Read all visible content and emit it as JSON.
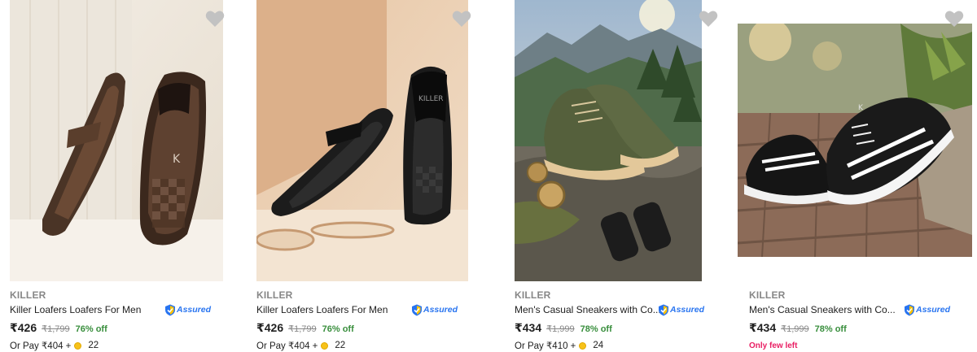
{
  "products": [
    {
      "brand": "KILLER",
      "title": "Killer Loafers Loafers For Men",
      "assured_label": "Assured",
      "price": "₹426",
      "mrp": "₹1,799",
      "discount": "76% off",
      "pay_prefix": "Or Pay ₹404 +",
      "coins": "22",
      "image_icon": "brown-loafers-image"
    },
    {
      "brand": "KILLER",
      "title": "Killer Loafers Loafers For Men",
      "assured_label": "Assured",
      "price": "₹426",
      "mrp": "₹1,799",
      "discount": "76% off",
      "pay_prefix": "Or Pay ₹404 +",
      "coins": "22",
      "image_icon": "black-loafers-image"
    },
    {
      "brand": "KILLER",
      "title": "Men's Casual Sneakers with Co...",
      "assured_label": "Assured",
      "price": "₹434",
      "mrp": "₹1,999",
      "discount": "78% off",
      "pay_prefix": "Or Pay ₹410 +",
      "coins": "24",
      "image_icon": "olive-sneakers-image"
    },
    {
      "brand": "KILLER",
      "title": "Men's Casual Sneakers with Co...",
      "assured_label": "Assured",
      "price": "₹434",
      "mrp": "₹1,999",
      "discount": "78% off",
      "stock_note": "Only few left",
      "image_icon": "black-sneakers-image"
    }
  ],
  "colors": {
    "brand_grey": "#878787",
    "discount_green": "#388e3c",
    "assured_blue": "#2874f0",
    "stock_pink": "#e91e63",
    "coin_gold": "#f7c21a"
  }
}
